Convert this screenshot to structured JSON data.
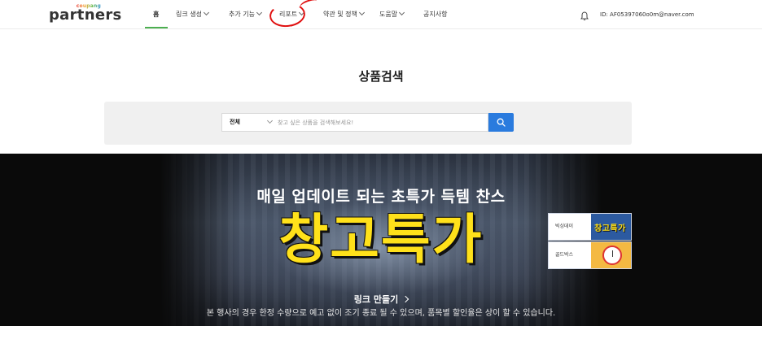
{
  "header": {
    "logo": {
      "top": "coupang",
      "main": "partners"
    },
    "nav": [
      {
        "label": "홈",
        "has_dropdown": false,
        "active": true
      },
      {
        "label": "링크 생성",
        "has_dropdown": true
      },
      {
        "label": "추가 기능",
        "has_dropdown": true
      },
      {
        "label": "리포트",
        "has_dropdown": true
      },
      {
        "label": "약관 및 정책",
        "has_dropdown": true
      },
      {
        "label": "도움말",
        "has_dropdown": true
      },
      {
        "label": "공지사항",
        "has_dropdown": false
      }
    ],
    "icons": {
      "notifications": "bell-icon"
    },
    "user": {
      "id": "ID: AF0539706",
      "email": "0o0m@naver.com"
    }
  },
  "search": {
    "title": "상품검색",
    "category": "전체",
    "placeholder": "찾고 싶은 상품을 검색해보세요!",
    "button_icon": "search-icon"
  },
  "banner": {
    "headline": "매일 업데이트 되는 초특가 득템 찬스",
    "big_text": "창고특가",
    "cta": "링크 만들기",
    "note": "본 행사의 경우 한정 수량으로 예고 없이 조기 종료 될 수 있으며, 품목별 할인율은 상이 할 수 있습니다.",
    "side_cards": [
      {
        "label": "빅싱데이",
        "thumb_text": "창고특가"
      },
      {
        "label": "골드박스"
      }
    ]
  },
  "colors": {
    "accent_blue": "#2a7bde",
    "nav_active_underline": "#4caf50",
    "banner_yellow": "#ffe11a",
    "annotation_red": "#e01010"
  }
}
